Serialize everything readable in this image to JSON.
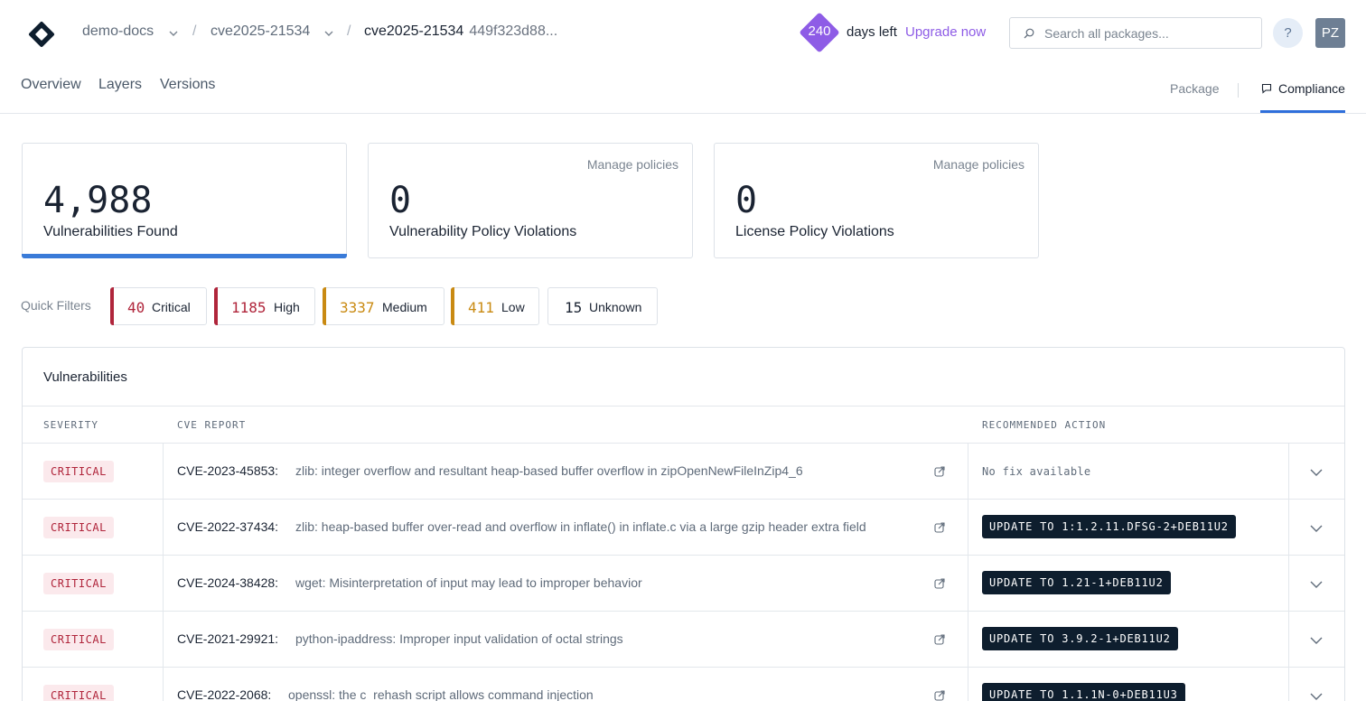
{
  "header": {
    "breadcrumbs": [
      {
        "label": "demo-docs"
      },
      {
        "label": "cve2025-21534"
      },
      {
        "label": "cve2025-21534",
        "hash": "449f323d88..."
      }
    ],
    "days_count": "240",
    "days_left_label": "days left",
    "upgrade_label": "Upgrade now",
    "search_placeholder": "Search all packages...",
    "help_label": "?",
    "avatar_initials": "PZ"
  },
  "tabs": {
    "left": [
      "Overview",
      "Layers",
      "Versions"
    ],
    "right": {
      "package": "Package",
      "compliance": "Compliance"
    }
  },
  "stats": [
    {
      "value": "4,988",
      "label": "Vulnerabilities Found",
      "manage": ""
    },
    {
      "value": "0",
      "label": "Vulnerability Policy Violations",
      "manage": "Manage policies"
    },
    {
      "value": "0",
      "label": "License Policy Violations",
      "manage": "Manage policies"
    }
  ],
  "quick_filters": {
    "label": "Quick Filters",
    "items": [
      {
        "count": "40",
        "name": "Critical",
        "color": "#b0253b"
      },
      {
        "count": "1185",
        "name": "High",
        "color": "#b0253b"
      },
      {
        "count": "3337",
        "name": "Medium",
        "color": "#c98a12"
      },
      {
        "count": "411",
        "name": "Low",
        "color": "#c98a12"
      },
      {
        "count": "15",
        "name": "Unknown",
        "color": "#1a2332"
      }
    ]
  },
  "vulnerabilities": {
    "title": "Vulnerabilities",
    "columns": [
      "SEVERITY",
      "CVE REPORT",
      "RECOMMENDED ACTION"
    ],
    "rows": [
      {
        "severity": "CRITICAL",
        "id": "CVE-2023-45853:",
        "desc": "zlib: integer overflow and resultant heap-based buffer overflow in zipOpenNewFileInZip4_6",
        "action": "No fix available",
        "has_fix": false
      },
      {
        "severity": "CRITICAL",
        "id": "CVE-2022-37434:",
        "desc": "zlib: heap-based buffer over-read and overflow in inflate() in inflate.c via a large gzip header extra field",
        "action": "UPDATE TO 1:1.2.11.DFSG-2+DEB11U2",
        "has_fix": true
      },
      {
        "severity": "CRITICAL",
        "id": "CVE-2024-38428:",
        "desc": "wget: Misinterpretation of input may lead to improper behavior",
        "action": "UPDATE TO 1.21-1+DEB11U2",
        "has_fix": true
      },
      {
        "severity": "CRITICAL",
        "id": "CVE-2021-29921:",
        "desc": "python-ipaddress: Improper input validation of octal strings",
        "action": "UPDATE TO 3.9.2-1+DEB11U2",
        "has_fix": true
      },
      {
        "severity": "CRITICAL",
        "id": "CVE-2022-2068:",
        "desc": "openssl: the c_rehash script allows command injection",
        "action": "UPDATE TO 1.1.1N-0+DEB11U3",
        "has_fix": true
      }
    ]
  },
  "colors": {
    "accent": "#3a7bd8",
    "upgrade": "#8e5ce6",
    "critical": "#b0253b"
  }
}
